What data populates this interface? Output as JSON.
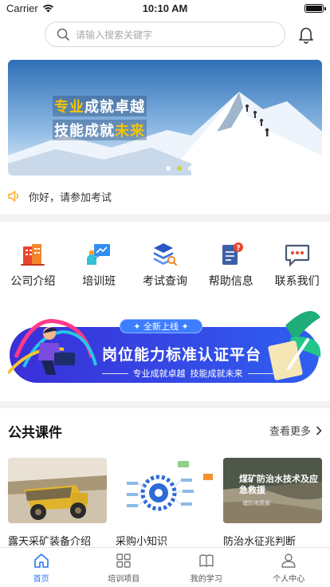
{
  "status_bar": {
    "carrier": "Carrier",
    "time": "10:10 AM"
  },
  "search": {
    "placeholder": "请输入搜索关键字"
  },
  "banner": {
    "line1_a": "专业",
    "line1_b": "成就卓越",
    "line2_a": "技能成就",
    "line2_b": "未来",
    "highlight_color": "#f5c400"
  },
  "notice": {
    "text": "你好，请参加考试"
  },
  "categories": [
    {
      "label": "公司介绍",
      "icon": "company-icon"
    },
    {
      "label": "培训班",
      "icon": "training-icon"
    },
    {
      "label": "考试查询",
      "icon": "exam-icon"
    },
    {
      "label": "帮助信息",
      "icon": "help-icon"
    },
    {
      "label": "联系我们",
      "icon": "contact-icon"
    }
  ],
  "promo": {
    "pill": "全新上线",
    "title": "岗位能力标准认证平台",
    "sub_a": "专业成就卓越",
    "sub_b": "技能成就未来",
    "accent": "#2f49e6"
  },
  "courses_section": {
    "title": "公共课件",
    "more": "查看更多",
    "items": [
      {
        "title": "露天采矿装备介绍"
      },
      {
        "title": "采购小知识"
      },
      {
        "title": "防治水征兆判断",
        "thumb_text": "煤矿防治水技术及应急救援",
        "thumb_caption": "诸防地质部"
      }
    ]
  },
  "tabbar": {
    "items": [
      {
        "label": "首页",
        "active": true
      },
      {
        "label": "培训项目",
        "active": false
      },
      {
        "label": "我的学习",
        "active": false
      },
      {
        "label": "个人中心",
        "active": false
      }
    ],
    "active_color": "#2a76f0"
  }
}
